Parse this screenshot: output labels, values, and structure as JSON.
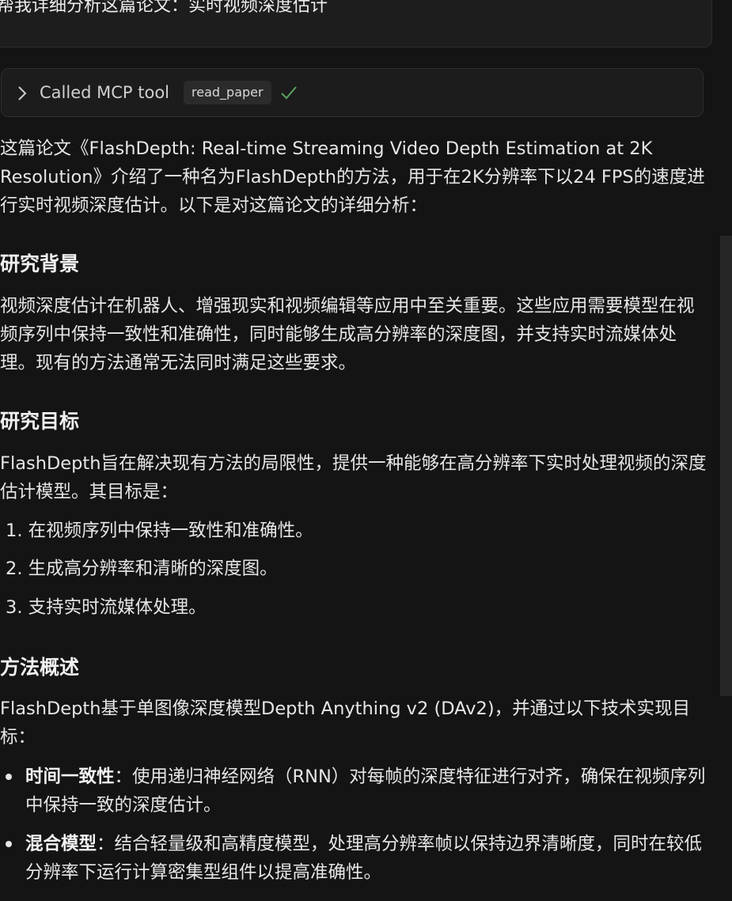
{
  "user_message": {
    "text": "帮我详细分析这篇论文：实时视频深度估计"
  },
  "tool_call": {
    "label": "Called MCP tool",
    "tool_name": "read_paper",
    "status_icon": "check-icon",
    "accent_color": "#5aa35f"
  },
  "response": {
    "intro": "这篇论文《FlashDepth: Real-time Streaming Video Depth Estimation at 2K Resolution》介绍了一种名为FlashDepth的方法，用于在2K分辨率下以24 FPS的速度进行实时视频深度估计。以下是对这篇论文的详细分析：",
    "sections": {
      "background": {
        "heading": "研究背景",
        "body": "视频深度估计在机器人、增强现实和视频编辑等应用中至关重要。这些应用需要模型在视频序列中保持一致性和准确性，同时能够生成高分辨率的深度图，并支持实时流媒体处理。现有的方法通常无法同时满足这些要求。"
      },
      "goals": {
        "heading": "研究目标",
        "body": "FlashDepth旨在解决现有方法的局限性，提供一种能够在高分辨率下实时处理视频的深度估计模型。其目标是：",
        "items": [
          "1. 在视频序列中保持一致性和准确性。",
          "2. 生成高分辨率和清晰的深度图。",
          "3. 支持实时流媒体处理。"
        ]
      },
      "method": {
        "heading": "方法概述",
        "body": "FlashDepth基于单图像深度模型Depth Anything v2 (DAv2)，并通过以下技术实现目标：",
        "bullets": [
          {
            "term": "时间一致性",
            "text": "：使用递归神经网络（RNN）对每帧的深度特征进行对齐，确保在视频序列中保持一致的深度估计。"
          },
          {
            "term": "混合模型",
            "text": "：结合轻量级和高精度模型，处理高分辨率帧以保持边界清晰度，同时在较低分辨率下运行计算密集型组件以提高准确性。"
          }
        ]
      }
    }
  }
}
